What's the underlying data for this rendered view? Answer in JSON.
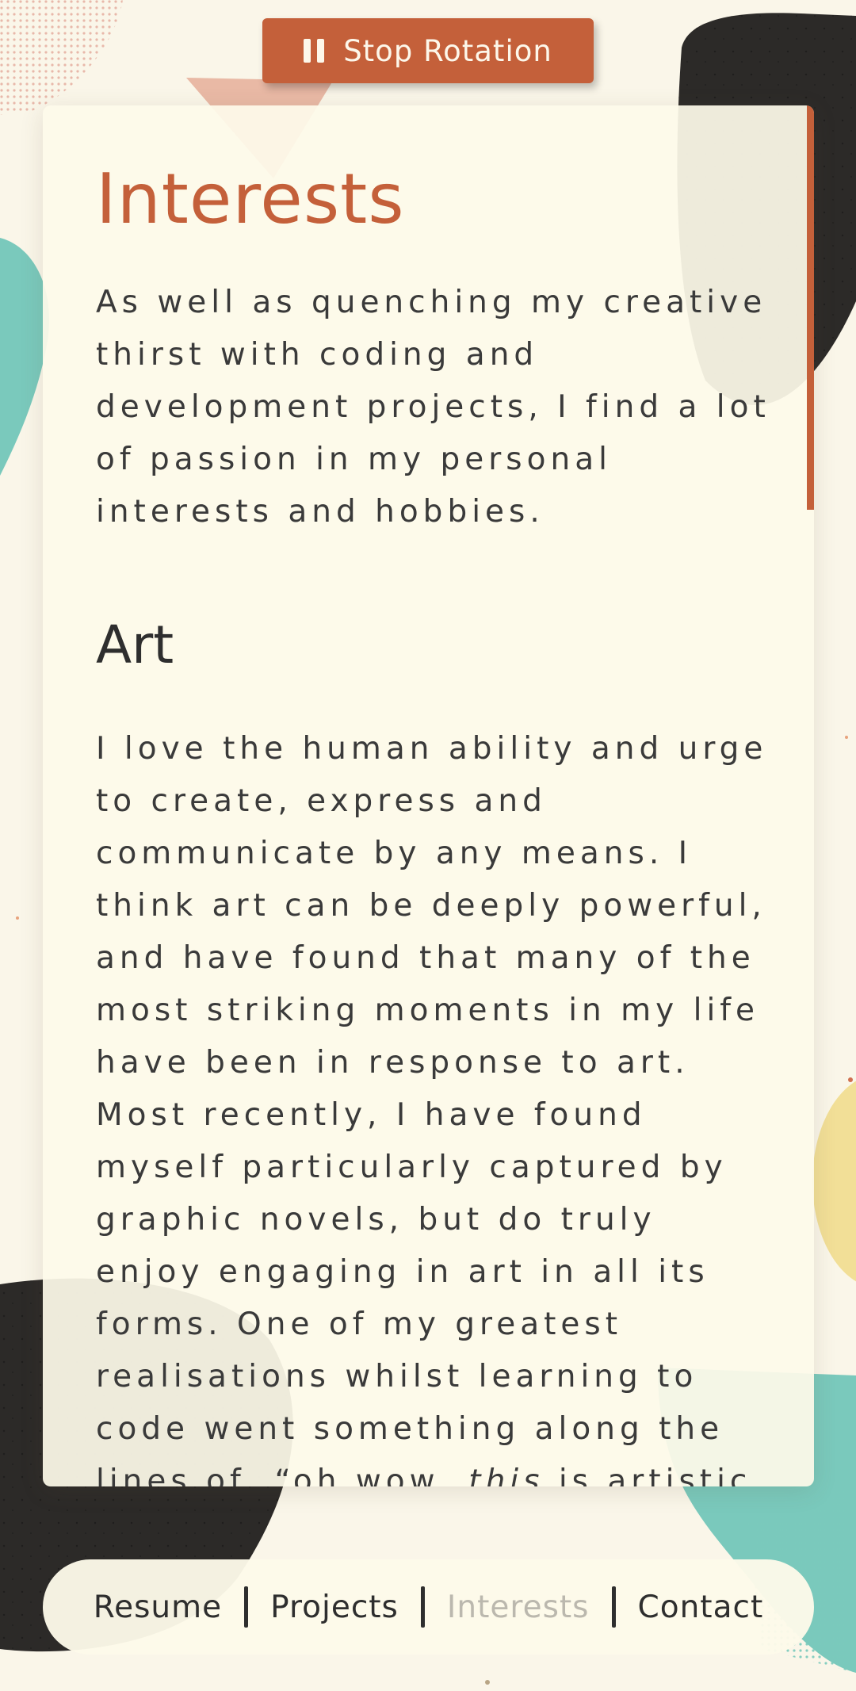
{
  "stop_button": {
    "label": "Stop Rotation",
    "icon": "pause-icon"
  },
  "main": {
    "title": "Interests",
    "intro": "As well as quenching my creative thirst with coding and development projects, I find a lot of passion in my personal interests and hobbies.",
    "section": {
      "heading": "Art",
      "body_before": "I love the human ability and urge to create, express and communicate by any means. I think art can be deeply powerful, and have found that many of the most striking moments in my life have been in response to art. Most recently, I have found myself particularly captured by graphic novels, but do truly enjoy engaging in art in all its forms. One of my greatest realisations whilst learning to code went something along the lines of, “oh wow, ",
      "body_emphasis": "this",
      "body_after": " is artistic too. Like"
    }
  },
  "nav": {
    "items": [
      {
        "label": "Resume",
        "active": false
      },
      {
        "label": "Projects",
        "active": false
      },
      {
        "label": "Interests",
        "active": true
      },
      {
        "label": "Contact",
        "active": false
      }
    ]
  },
  "colors": {
    "accent": "#c4603a",
    "background": "#faf6e9",
    "card": "#fdfae9",
    "text": "#3a3a3a",
    "nav_active": "#bbb8ae",
    "teal": "#7ac9bc",
    "yellow": "#f2df97",
    "dark": "#2c2a28"
  }
}
